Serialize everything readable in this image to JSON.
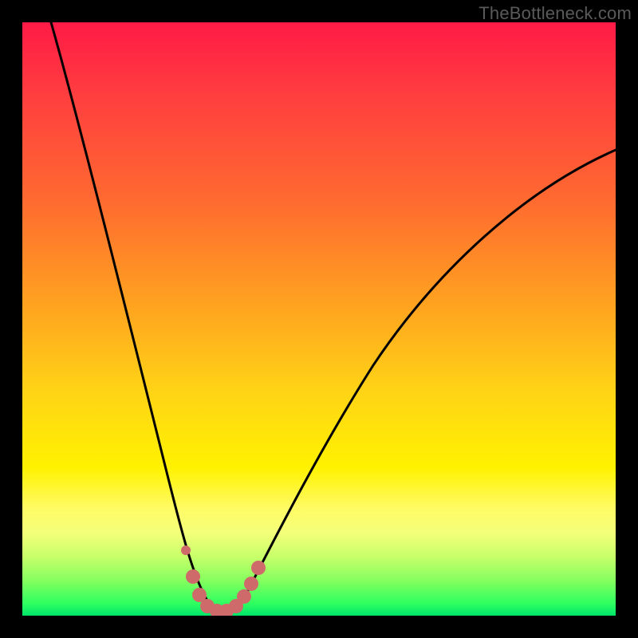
{
  "watermark": "TheBottleneck.com",
  "colors": {
    "curve": "#000000",
    "dots": "#cf6a6a",
    "gradient_top": "#ff1a46",
    "gradient_mid": "#fff200",
    "gradient_bottom": "#00e36a",
    "frame": "#000000"
  },
  "chart_data": {
    "type": "line",
    "title": "",
    "xlabel": "",
    "ylabel": "",
    "xlim": [
      0,
      100
    ],
    "ylim": [
      0,
      100
    ],
    "annotations": [
      "TheBottleneck.com"
    ],
    "notes": "V-shaped bottleneck curve on red-yellow-green gradient; minimum near x≈32; salmon dotted overlay follows curve in y≲10 band.",
    "series": [
      {
        "name": "curve",
        "stroke": "#000000",
        "x": [
          5,
          7,
          10,
          13,
          16,
          19,
          22,
          25,
          27,
          29,
          31,
          33,
          35,
          37,
          40,
          45,
          50,
          55,
          60,
          65,
          70,
          75,
          80,
          85,
          90,
          95,
          100
        ],
        "values": [
          100,
          90,
          77,
          65,
          54,
          44,
          34,
          24,
          17,
          10,
          4,
          1,
          1,
          4,
          10,
          20,
          29,
          37,
          44,
          50,
          55,
          59,
          63,
          66,
          69,
          72,
          74
        ]
      },
      {
        "name": "dots",
        "stroke": "#cf6a6a",
        "style": "dots",
        "x": [
          27.5,
          29,
          30,
          31,
          32,
          33,
          34,
          35,
          36,
          37
        ],
        "values": [
          10,
          5.5,
          3,
          1.5,
          1,
          1,
          1.5,
          2.5,
          4,
          7
        ]
      }
    ]
  }
}
